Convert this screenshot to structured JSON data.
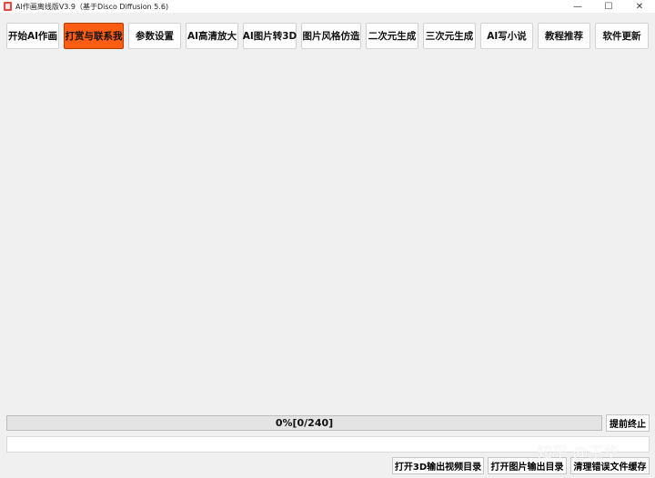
{
  "window": {
    "title": "AI作画离线版V3.9（基于Disco Diffusion 5.6)",
    "icon": "app-icon",
    "controls": {
      "minimize": "—",
      "maximize": "☐",
      "close": "✕"
    }
  },
  "toolbar": {
    "items": [
      {
        "label": "开始AI作画",
        "active": false
      },
      {
        "label": "打赏与联系我",
        "active": true
      },
      {
        "label": "参数设置",
        "active": false
      },
      {
        "label": "AI高清放大",
        "active": false
      },
      {
        "label": "AI图片转3D",
        "active": false
      },
      {
        "label": "图片风格仿造",
        "active": false
      },
      {
        "label": "二次元生成",
        "active": false
      },
      {
        "label": "三次元生成",
        "active": false
      },
      {
        "label": "AI写小说",
        "active": false
      },
      {
        "label": "教程推荐",
        "active": false
      },
      {
        "label": "软件更新",
        "active": false
      }
    ],
    "active_color": "#ff5e12"
  },
  "progress": {
    "text": "0%[0/240]",
    "current": 0,
    "total": 240,
    "stop_label": "提前终止"
  },
  "log": {
    "value": ""
  },
  "bottom_buttons": {
    "open_3d": "打开3D输出视频目录",
    "open_images": "打开图片输出目录",
    "clear_cache": "清理错误文件缓存"
  },
  "watermark": "知乎 @王华"
}
